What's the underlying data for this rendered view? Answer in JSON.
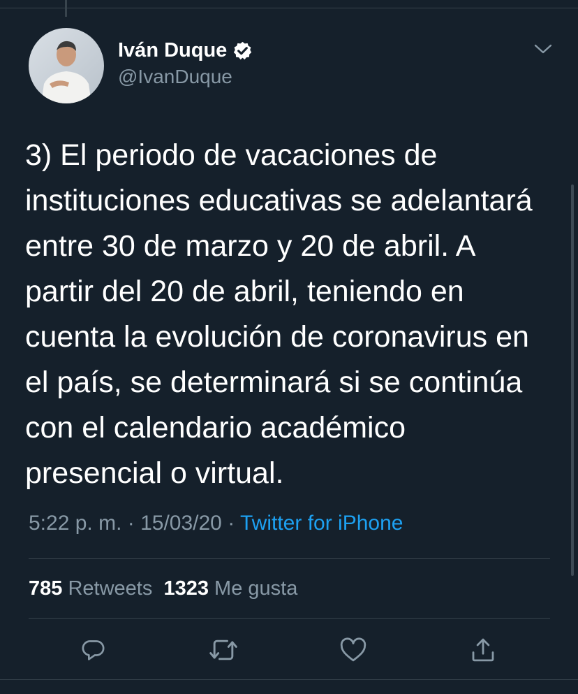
{
  "author": {
    "name": "Iván Duque",
    "handle": "@IvanDuque",
    "verified": true
  },
  "tweet": {
    "text": "3) El periodo de vacaciones de\ninstituciones educativas se adelantará\nentre 30 de marzo y 20 de abril. A\npartir del 20 de abril, teniendo en\ncuenta la evolución de coronavirus en\nel país, se determinará si se continúa\ncon el calendario académico\npresencial o virtual.",
    "time": "5:22 p. m.",
    "date": "15/03/20",
    "separator": "·",
    "source": "Twitter for iPhone"
  },
  "stats": {
    "retweets_count": "785",
    "retweets_label": "Retweets",
    "likes_count": "1323",
    "likes_label": "Me gusta"
  },
  "icons": {
    "verified": "verified-badge-icon",
    "more": "chevron-down-icon",
    "reply": "reply-icon",
    "retweet": "retweet-icon",
    "like": "heart-icon",
    "share": "share-icon"
  },
  "colors": {
    "background": "#15202b",
    "accent": "#1da1f2",
    "secondary_text": "#8899a6",
    "divider": "#38444d"
  }
}
